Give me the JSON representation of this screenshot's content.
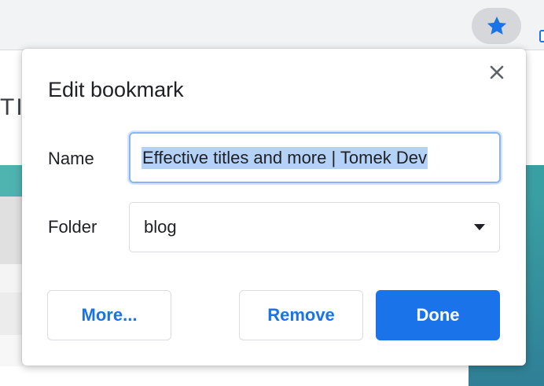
{
  "toolbar": {
    "star_icon": "star-icon",
    "accent_color": "#1a73e8"
  },
  "background": {
    "partial_heading": "TI"
  },
  "dialog": {
    "title": "Edit bookmark",
    "close_icon": "close-icon",
    "name_label": "Name",
    "name_value": "Effective titles and more | Tomek Dev",
    "folder_label": "Folder",
    "folder_value": "blog",
    "buttons": {
      "more": "More...",
      "remove": "Remove",
      "done": "Done"
    }
  }
}
